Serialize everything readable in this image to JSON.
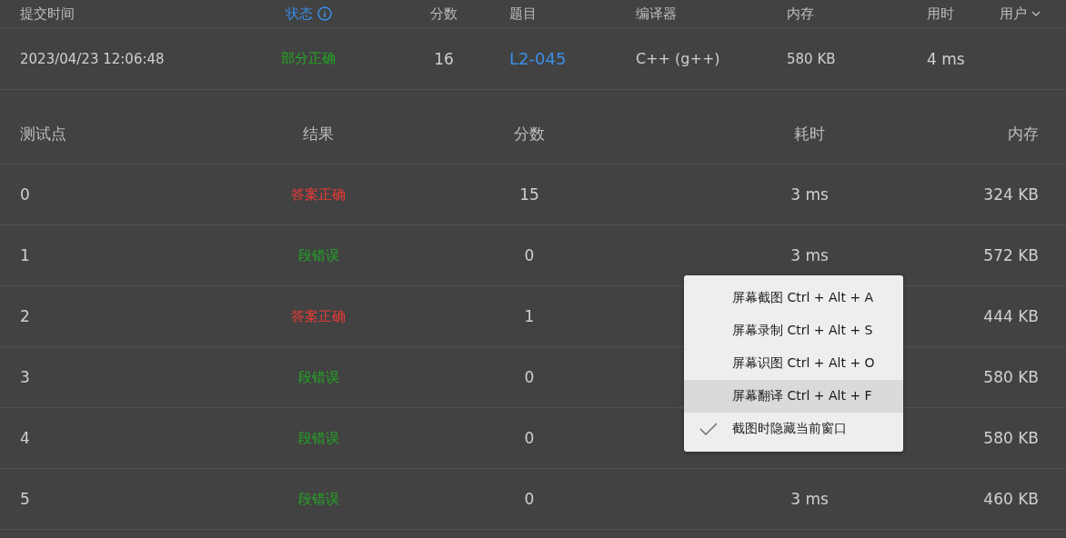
{
  "submission": {
    "columns": [
      {
        "label": "提交时间"
      },
      {
        "label": "状态",
        "info": true
      },
      {
        "label": "分数"
      },
      {
        "label": "题目"
      },
      {
        "label": "编译器"
      },
      {
        "label": "内存"
      },
      {
        "label": "用时"
      },
      {
        "label": "用户",
        "sortable": true
      }
    ],
    "row": {
      "time": "2023/04/23 12:06:48",
      "status": {
        "text": "部分正确",
        "kind": "partial"
      },
      "score": "16",
      "problem": "L2-045",
      "compiler": "C++ (g++)",
      "memory": "580 KB",
      "duration": "4 ms"
    }
  },
  "cases": {
    "columns": [
      "测试点",
      "结果",
      "分数",
      "耗时",
      "内存"
    ],
    "rows": [
      {
        "id": "0",
        "result": {
          "text": "答案正确",
          "kind": "correct"
        },
        "score": "15",
        "time": "3 ms",
        "memory": "324 KB"
      },
      {
        "id": "1",
        "result": {
          "text": "段错误",
          "kind": "error"
        },
        "score": "0",
        "time": "3 ms",
        "memory": "572 KB"
      },
      {
        "id": "2",
        "result": {
          "text": "答案正确",
          "kind": "correct"
        },
        "score": "1",
        "memory": "444 KB"
      },
      {
        "id": "3",
        "result": {
          "text": "段错误",
          "kind": "error"
        },
        "score": "0",
        "memory": "580 KB"
      },
      {
        "id": "4",
        "result": {
          "text": "段错误",
          "kind": "error"
        },
        "score": "0",
        "memory": "580 KB"
      },
      {
        "id": "5",
        "result": {
          "text": "段错误",
          "kind": "error"
        },
        "score": "0",
        "time": "3 ms",
        "memory": "460 KB"
      }
    ]
  },
  "context_menu": {
    "items": [
      {
        "label": "屏幕截图 Ctrl + Alt + A",
        "selected": false,
        "checked": false
      },
      {
        "label": "屏幕录制 Ctrl + Alt + S",
        "selected": false,
        "checked": false
      },
      {
        "label": "屏幕识图 Ctrl + Alt + O",
        "selected": false,
        "checked": false
      },
      {
        "label": "屏幕翻译 Ctrl + Alt + F",
        "selected": true,
        "checked": false
      },
      {
        "label": "截图时隐藏当前窗口",
        "selected": false,
        "checked": true
      }
    ]
  }
}
